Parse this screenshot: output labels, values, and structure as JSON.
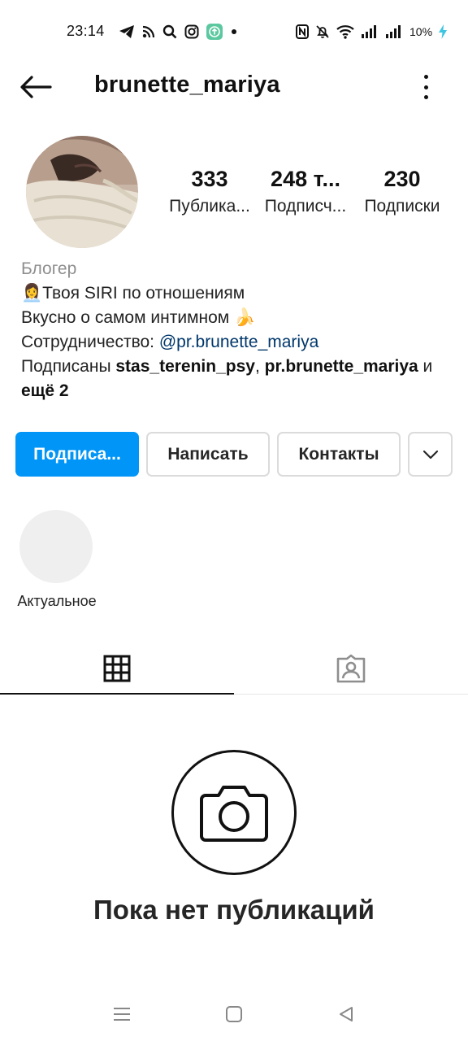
{
  "status_bar": {
    "time": "23:14",
    "battery": "10%",
    "left_icons": [
      "telegram-icon",
      "rss-icon",
      "search-icon",
      "instagram-icon",
      "upload-app-icon",
      "dot-icon"
    ],
    "right_icons": [
      "nfc-icon",
      "mute-icon",
      "wifi-icon",
      "signal-icon",
      "signal-icon",
      "charging-icon"
    ]
  },
  "header": {
    "username": "brunette_mariya"
  },
  "profile": {
    "stats": [
      {
        "value": "333",
        "label": "Публика..."
      },
      {
        "value": "248 т...",
        "label": "Подписч..."
      },
      {
        "value": "230",
        "label": "Подписки"
      }
    ],
    "bio": {
      "category": "Блогер",
      "line1_emoji": "👩‍💼",
      "line1": "Твоя SIRI по отношениям",
      "line2": "Вкусно о самом интимном",
      "line2_emoji": "🍌",
      "line3_prefix": "Сотрудничество: ",
      "line3_mention": "@pr.brunette_mariya",
      "followed_prefix": "Подписаны ",
      "followed_names": "stas_terenin_psy",
      "followed_sep": ", ",
      "followed_names2": "pr.brunette_mariya",
      "followed_and": " и",
      "followed_more": "ещё 2"
    }
  },
  "actions": {
    "follow": "Подписа...",
    "message": "Написать",
    "contacts": "Контакты"
  },
  "highlights": {
    "label": "Актуальное"
  },
  "tabs": [
    "grid-icon",
    "tagged-icon"
  ],
  "empty_state": {
    "text": "Пока нет публикаций"
  },
  "colors": {
    "accent": "#0095f6",
    "mention": "#00376b",
    "muted": "#8e8e8e"
  }
}
